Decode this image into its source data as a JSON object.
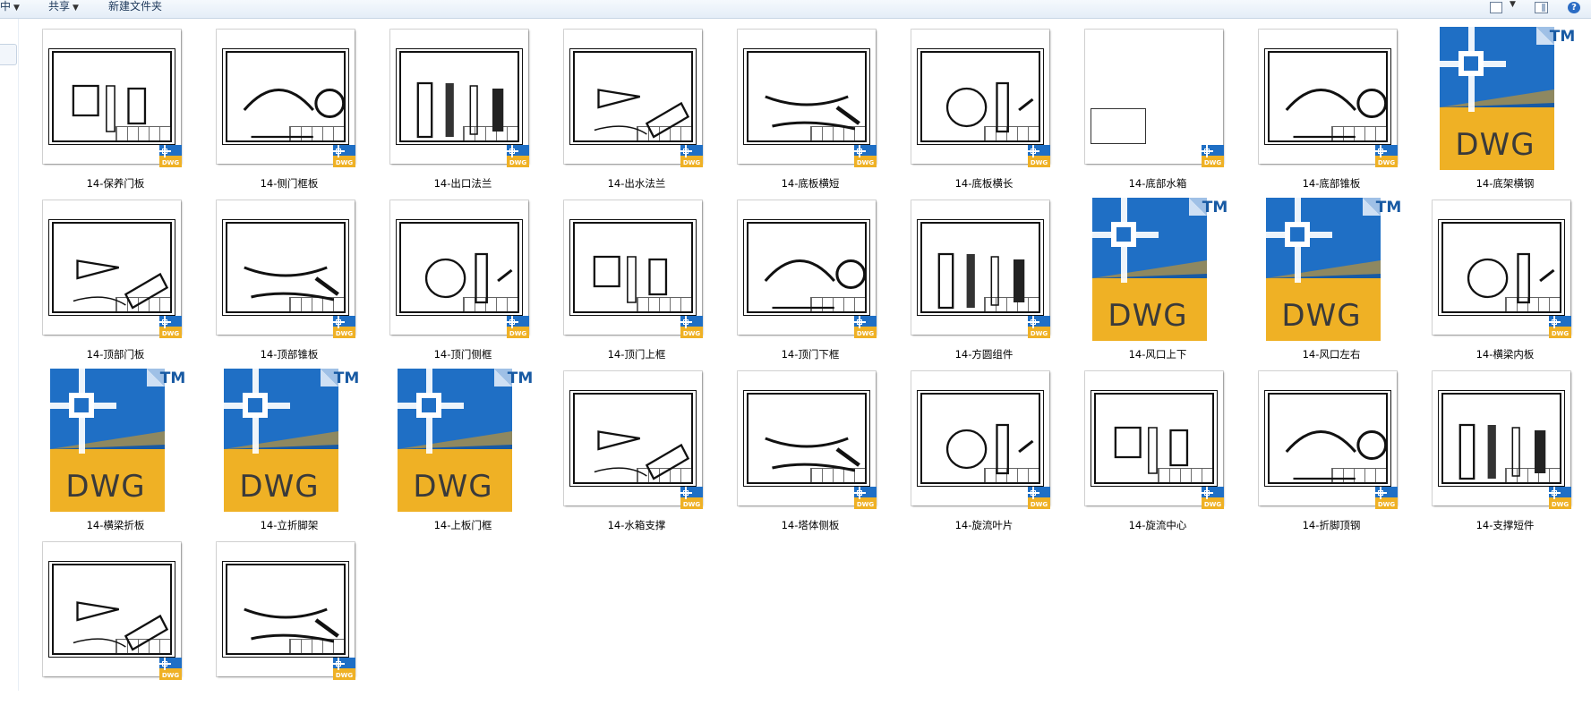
{
  "toolbar": {
    "items": [
      "中",
      "共享",
      "新建文件夹"
    ]
  },
  "icons": {
    "dwg_text": "DWG",
    "tm_text": "TM",
    "colors": {
      "blue": "#1f6fc5",
      "blue_dark": "#185aa3",
      "gold": "#efb125",
      "gold_dark": "#d89a1c",
      "fold": "#9fc0e6",
      "text_dark": "#3a3a3a"
    }
  },
  "files": [
    {
      "name": "14-保养门板",
      "kind": "thumb"
    },
    {
      "name": "14-侧门框板",
      "kind": "thumb"
    },
    {
      "name": "14-出口法兰",
      "kind": "thumb"
    },
    {
      "name": "14-出水法兰",
      "kind": "thumb"
    },
    {
      "name": "14-底板横短",
      "kind": "thumb"
    },
    {
      "name": "14-底板横长",
      "kind": "thumb"
    },
    {
      "name": "14-底部水箱",
      "kind": "thumb-small"
    },
    {
      "name": "14-底部锥板",
      "kind": "thumb"
    },
    {
      "name": "14-底架横钢",
      "kind": "icon"
    },
    {
      "name": "14-顶部门板",
      "kind": "thumb"
    },
    {
      "name": "14-顶部锥板",
      "kind": "thumb"
    },
    {
      "name": "14-顶门侧框",
      "kind": "thumb"
    },
    {
      "name": "14-顶门上框",
      "kind": "thumb"
    },
    {
      "name": "14-顶门下框",
      "kind": "thumb"
    },
    {
      "name": "14-方圆组件",
      "kind": "thumb"
    },
    {
      "name": "14-风口上下",
      "kind": "icon"
    },
    {
      "name": "14-风口左右",
      "kind": "icon"
    },
    {
      "name": "14-横梁内板",
      "kind": "thumb"
    },
    {
      "name": "14-横梁折板",
      "kind": "icon"
    },
    {
      "name": "14-立折脚架",
      "kind": "icon"
    },
    {
      "name": "14-上板门框",
      "kind": "icon"
    },
    {
      "name": "14-水箱支撑",
      "kind": "thumb"
    },
    {
      "name": "14-塔体侧板",
      "kind": "thumb"
    },
    {
      "name": "14-旋流叶片",
      "kind": "thumb"
    },
    {
      "name": "14-旋流中心",
      "kind": "thumb"
    },
    {
      "name": "14-折脚顶钢",
      "kind": "thumb"
    },
    {
      "name": "14-支撑短件",
      "kind": "thumb"
    },
    {
      "name": "",
      "kind": "thumb"
    },
    {
      "name": "",
      "kind": "thumb"
    }
  ]
}
